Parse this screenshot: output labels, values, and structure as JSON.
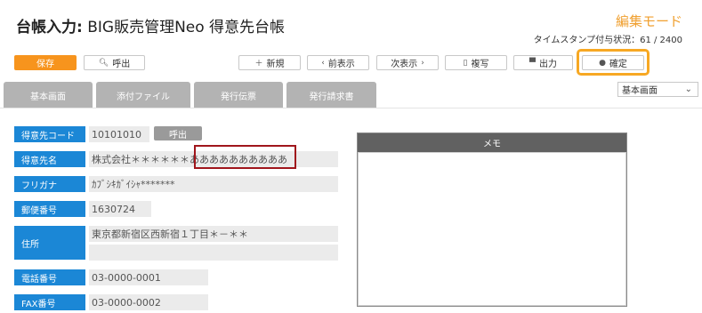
{
  "header": {
    "title_prefix": "台帳入力:",
    "title_main": " BIG販売管理Neo 得意先台帳",
    "mode": "編集モード",
    "timestamp": "タイムスタンプ付与状況：61 / 2400"
  },
  "toolbar": {
    "save": "保存",
    "call": "呼出",
    "new": "新規",
    "prev": "前表示",
    "next": "次表示",
    "copy": "複写",
    "print": "出力",
    "confirm": "確定"
  },
  "tabs": [
    "基本画面",
    "添付ファイル",
    "発行伝票",
    "発行請求書"
  ],
  "view_select": {
    "value": "基本画面"
  },
  "form": {
    "customer_code_label": "得意先コード",
    "customer_code": "10101010",
    "call_button": "呼出",
    "customer_name_label": "得意先名",
    "customer_name": "株式会社＊＊＊＊＊＊ああああああああああ",
    "furigana_label": "フリガナ",
    "furigana": "ｶﾌﾞｼｷｶﾞｲｼｬ*******",
    "postal_label": "郵便番号",
    "postal": "1630724",
    "address_label": "住所",
    "address1": "東京都新宿区西新宿１丁目＊－＊＊",
    "address2": "",
    "phone_label": "電話番号",
    "phone": "03-0000-0001",
    "fax_label": "FAX番号",
    "fax": "03-0000-0002"
  },
  "memo": {
    "title": "メモ",
    "content": ""
  },
  "colors": {
    "accent": "#f7941d",
    "label_bg": "#1b87d6",
    "highlight": "#f7a823",
    "annotation": "#a0161c"
  }
}
